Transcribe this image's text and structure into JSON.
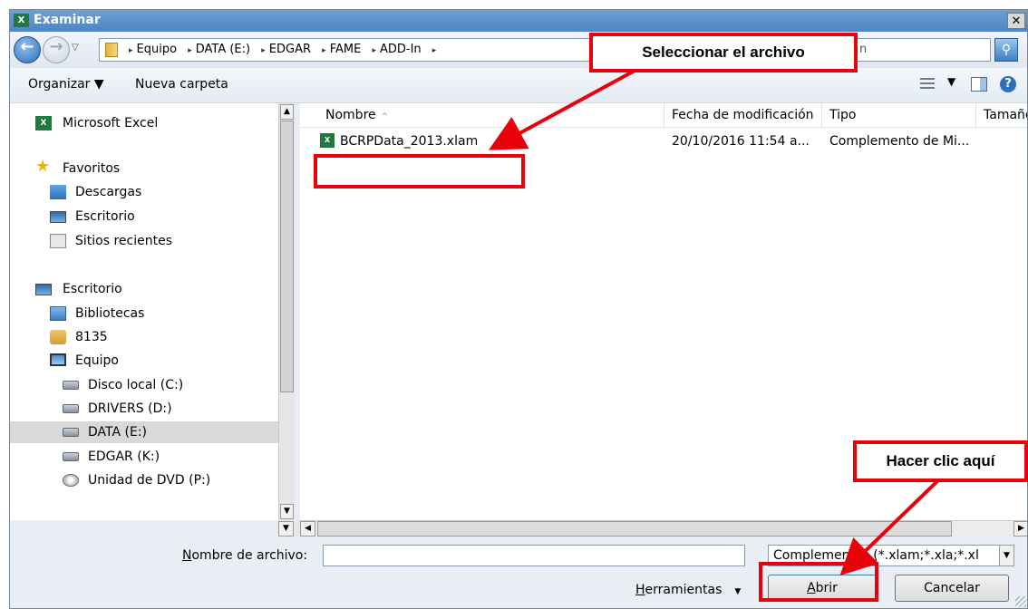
{
  "window": {
    "title": "Examinar",
    "title_icon": "X",
    "close_label": "✕"
  },
  "navigation": {
    "back_icon": "back-arrow-icon",
    "forward_icon": "forward-arrow-icon",
    "breadcrumb": [
      "Equipo",
      "DATA (E:)",
      "EDGAR",
      "FAME",
      "ADD-In"
    ],
    "search_placeholder_visible": "n"
  },
  "toolbar": {
    "organize_label": "Organizar ▼",
    "new_folder_label": "Nueva carpeta"
  },
  "nav_pane": {
    "items": [
      {
        "label": "Microsoft Excel",
        "icon": "excel-icon"
      },
      {
        "label": "Favoritos",
        "icon": "star-icon"
      },
      {
        "label": "Descargas",
        "icon": "downloads-icon"
      },
      {
        "label": "Escritorio",
        "icon": "desktop-icon"
      },
      {
        "label": "Sitios recientes",
        "icon": "recent-icon"
      },
      {
        "label": "Escritorio",
        "icon": "desktop-icon"
      },
      {
        "label": "Bibliotecas",
        "icon": "libraries-icon"
      },
      {
        "label": "8135",
        "icon": "user-folder-icon"
      },
      {
        "label": "Equipo",
        "icon": "computer-icon"
      },
      {
        "label": "Disco local (C:)",
        "icon": "drive-icon"
      },
      {
        "label": "DRIVERS (D:)",
        "icon": "drive-icon"
      },
      {
        "label": "DATA (E:)",
        "icon": "drive-icon",
        "selected": true
      },
      {
        "label": "EDGAR (K:)",
        "icon": "drive-icon"
      },
      {
        "label": "Unidad de DVD (P:)",
        "icon": "dvd-icon"
      }
    ]
  },
  "file_list": {
    "columns": [
      "Nombre",
      "Fecha de modificación",
      "Tipo",
      "Tamaño"
    ],
    "rows": [
      {
        "name": "BCRPData_2013.xlam",
        "date": "20/10/2016 11:54 a...",
        "type": "Complemento de Mi..."
      }
    ]
  },
  "bottom": {
    "filename_label": "Nombre de archivo:",
    "filename_value": "",
    "filetype_value": "Complementos (*.xlam;*.xla;*.xl",
    "tools_label": "Herramientas",
    "open_label": "Abrir",
    "cancel_label": "Cancelar"
  },
  "annotations": {
    "select_file": "Seleccionar el archivo",
    "click_here": "Hacer clic aquí",
    "highlight_color": "#e8000b"
  }
}
